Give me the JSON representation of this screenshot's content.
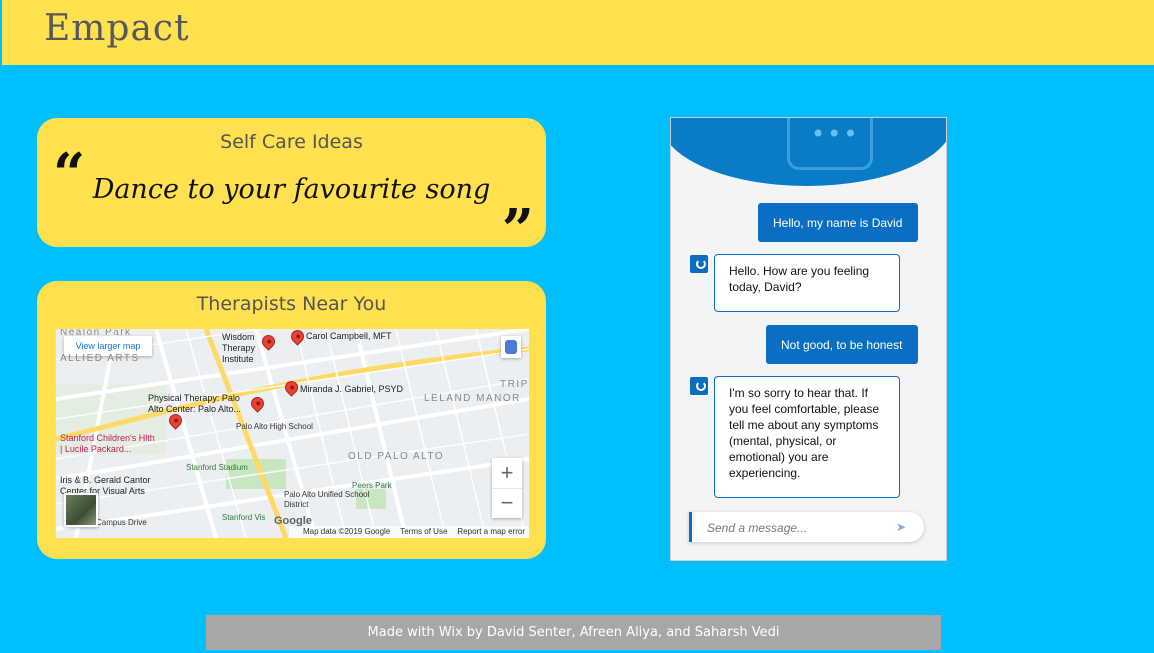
{
  "header": {
    "brand": "Empact",
    "background": "#ffe14f"
  },
  "self_care": {
    "title": "Self Care Ideas",
    "quote_open": "“",
    "quote_close": "”",
    "idea": "Dance to your favourite song"
  },
  "therapists": {
    "title": "Therapists Near You",
    "map": {
      "view_larger": "View larger map",
      "zoom_in": "+",
      "zoom_out": "−",
      "area_labels": [
        "ALLIED ARTS",
        "LELAND MANOR",
        "OLD PALO ALTO",
        "TRIP"
      ],
      "street_labels": [
        "Nealon Park",
        "Campus Drive",
        "Peers Park",
        "Palo Alto High School",
        "Stanford Stadium",
        "Palo Alto Unified School District",
        "Stanford Vis"
      ],
      "places": [
        {
          "name": "Wisdom Therapy Institute"
        },
        {
          "name": "Carol Campbell, MFT"
        },
        {
          "name": "Miranda J. Gabriel, PSYD"
        },
        {
          "name": "Physical Therapy: Palo Alto Center: Palo Alto..."
        },
        {
          "name": "Stanford Children's Hlth | Lucile Packard..."
        },
        {
          "name": "Iris & B. Gerald Cantor Center for Visual Arts"
        }
      ],
      "google": "Google",
      "footer": {
        "map_data": "Map data ©2019 Google",
        "terms": "Terms of Use",
        "report": "Report a map error"
      }
    }
  },
  "chat": {
    "messages": [
      {
        "from": "user",
        "text": "Hello, my name is David"
      },
      {
        "from": "bot",
        "text": "Hello. How are you feeling today, David?"
      },
      {
        "from": "user",
        "text": "Not good, to be honest"
      },
      {
        "from": "bot",
        "text": "I'm so sorry to hear that. If you feel comfortable, please tell me about any symptoms (mental, physical, or emotional) you are experiencing."
      }
    ],
    "input_placeholder": "Send a message...",
    "accent": "#0a6fc2"
  },
  "footer": {
    "credit": "Made with Wix by David Senter, Afreen Aliya, and Saharsh Vedi"
  },
  "colors": {
    "page_background": "#00bfff",
    "card_background": "#ffe14f",
    "footer_background": "#a7a7a7"
  }
}
